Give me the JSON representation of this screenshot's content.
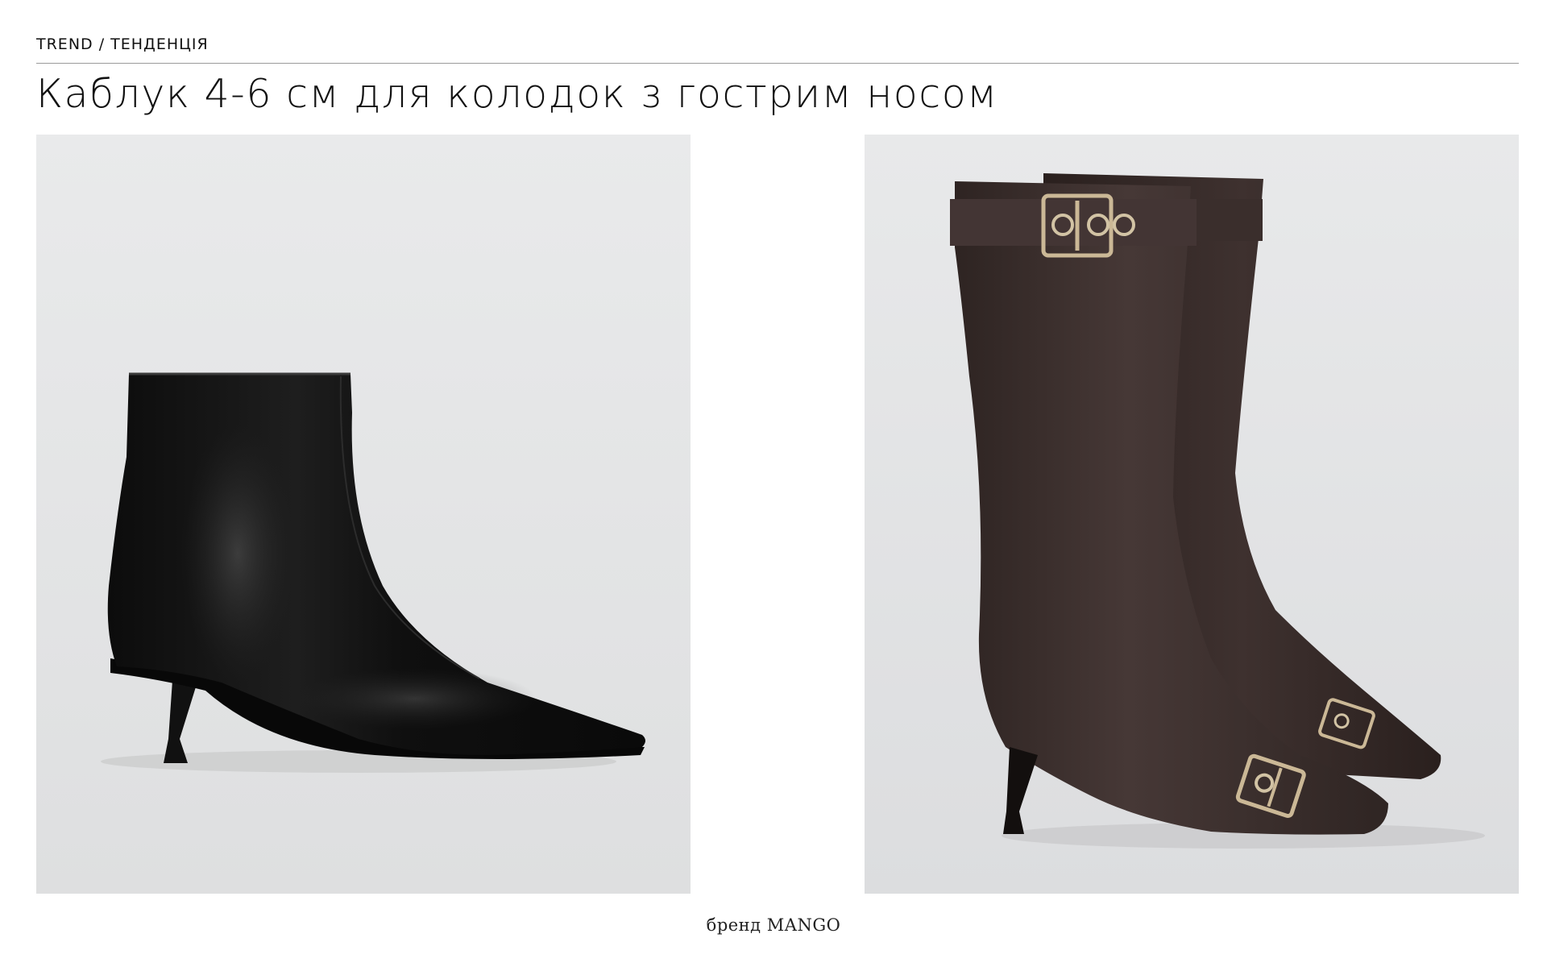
{
  "header": {
    "eyebrow": "TREND / ТЕНДЕНЦІЯ",
    "title": "Каблук 4-6 см для колодок з гострим носом"
  },
  "products": [
    {
      "name": "black-leather-kitten-heel-ankle-boot",
      "color": "#131313"
    },
    {
      "name": "brown-suede-knee-boots-with-buckles",
      "color": "#3d302d"
    }
  ],
  "footer": {
    "caption": "бренд MANGO"
  },
  "colors": {
    "panel_background": "#e6e7e8",
    "rule": "#9a9a9a",
    "text": "#111111"
  }
}
